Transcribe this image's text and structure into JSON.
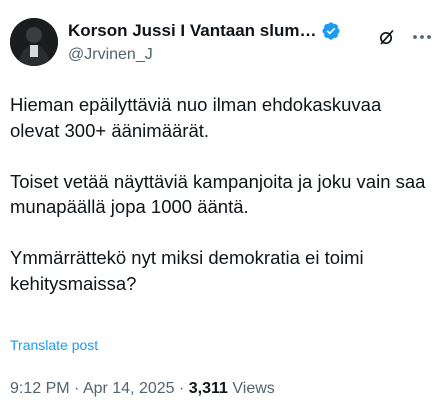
{
  "author": {
    "display_name": "Korson Jussi I Vantaan slum…",
    "handle": "@Jrvinen_J",
    "verified": true,
    "verified_color": "#1d9bf0",
    "avatar_icon": "avatar-photo"
  },
  "actions": {
    "grok_icon": "grok-icon",
    "more_icon": "more-dots-icon"
  },
  "tweet": {
    "paragraphs": [
      "Hieman epäilyttäviä nuo ilman ehdokaskuvaa olevat 300+ äänimäärät.",
      "Toiset vetää näyttäviä kampanjoita ja joku vain saa munapäällä jopa 1000 ääntä.",
      "Ymmärrättekö nyt miksi demokratia ei toimi kehitysmaissa?"
    ],
    "translate_label": "Translate post"
  },
  "meta": {
    "time": "9:12 PM",
    "separator": " · ",
    "date": "Apr 14, 2025",
    "views_count": "3,311",
    "views_label": " Views"
  },
  "colors": {
    "text": "#0f1419",
    "secondary": "#536471",
    "link": "#1d9bf0"
  }
}
